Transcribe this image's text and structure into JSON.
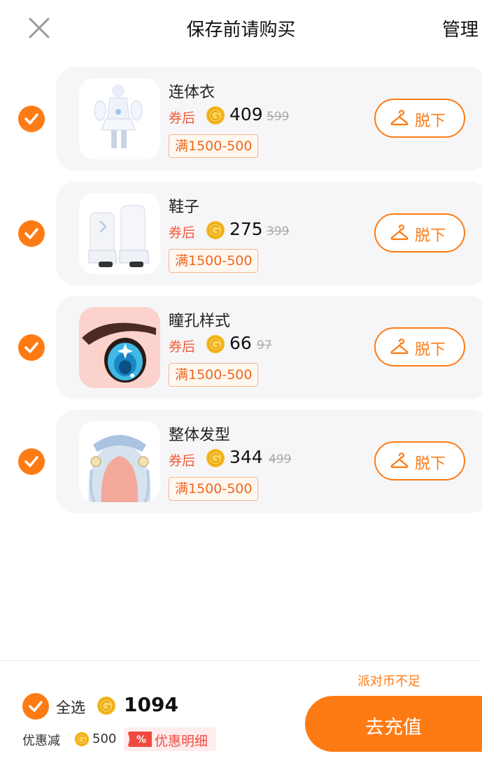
{
  "header": {
    "title": "保存前请购买",
    "manage_label": "管理"
  },
  "colors": {
    "accent": "#fe7b14",
    "price_red": "#f25b3a",
    "coin_gold": "#f4b81c"
  },
  "icons": {
    "close": "close-icon",
    "check": "check-icon",
    "coin": "coin-icon",
    "hanger": "hanger-icon",
    "discount": "percent-tag-icon"
  },
  "items": [
    {
      "name": "连体衣",
      "after_label": "券后",
      "price": "409",
      "original_price": "599",
      "coupon": "满1500-500",
      "remove_label": "脱下",
      "checked": true
    },
    {
      "name": "鞋子",
      "after_label": "券后",
      "price": "275",
      "original_price": "399",
      "coupon": "满1500-500",
      "remove_label": "脱下",
      "checked": true
    },
    {
      "name": "瞳孔样式",
      "after_label": "券后",
      "price": "66",
      "original_price": "97",
      "coupon": "满1500-500",
      "remove_label": "脱下",
      "checked": true
    },
    {
      "name": "整体发型",
      "after_label": "券后",
      "price": "344",
      "original_price": "499",
      "coupon": "满1500-500",
      "remove_label": "脱下",
      "checked": true
    }
  ],
  "footer": {
    "insufficient": "派对币不足",
    "select_all_label": "全选",
    "total": "1094",
    "discount_label": "优惠减",
    "discount_value": "500",
    "discount_tag": "%",
    "detail_label": "优惠明细",
    "recharge_label": "去充值"
  }
}
